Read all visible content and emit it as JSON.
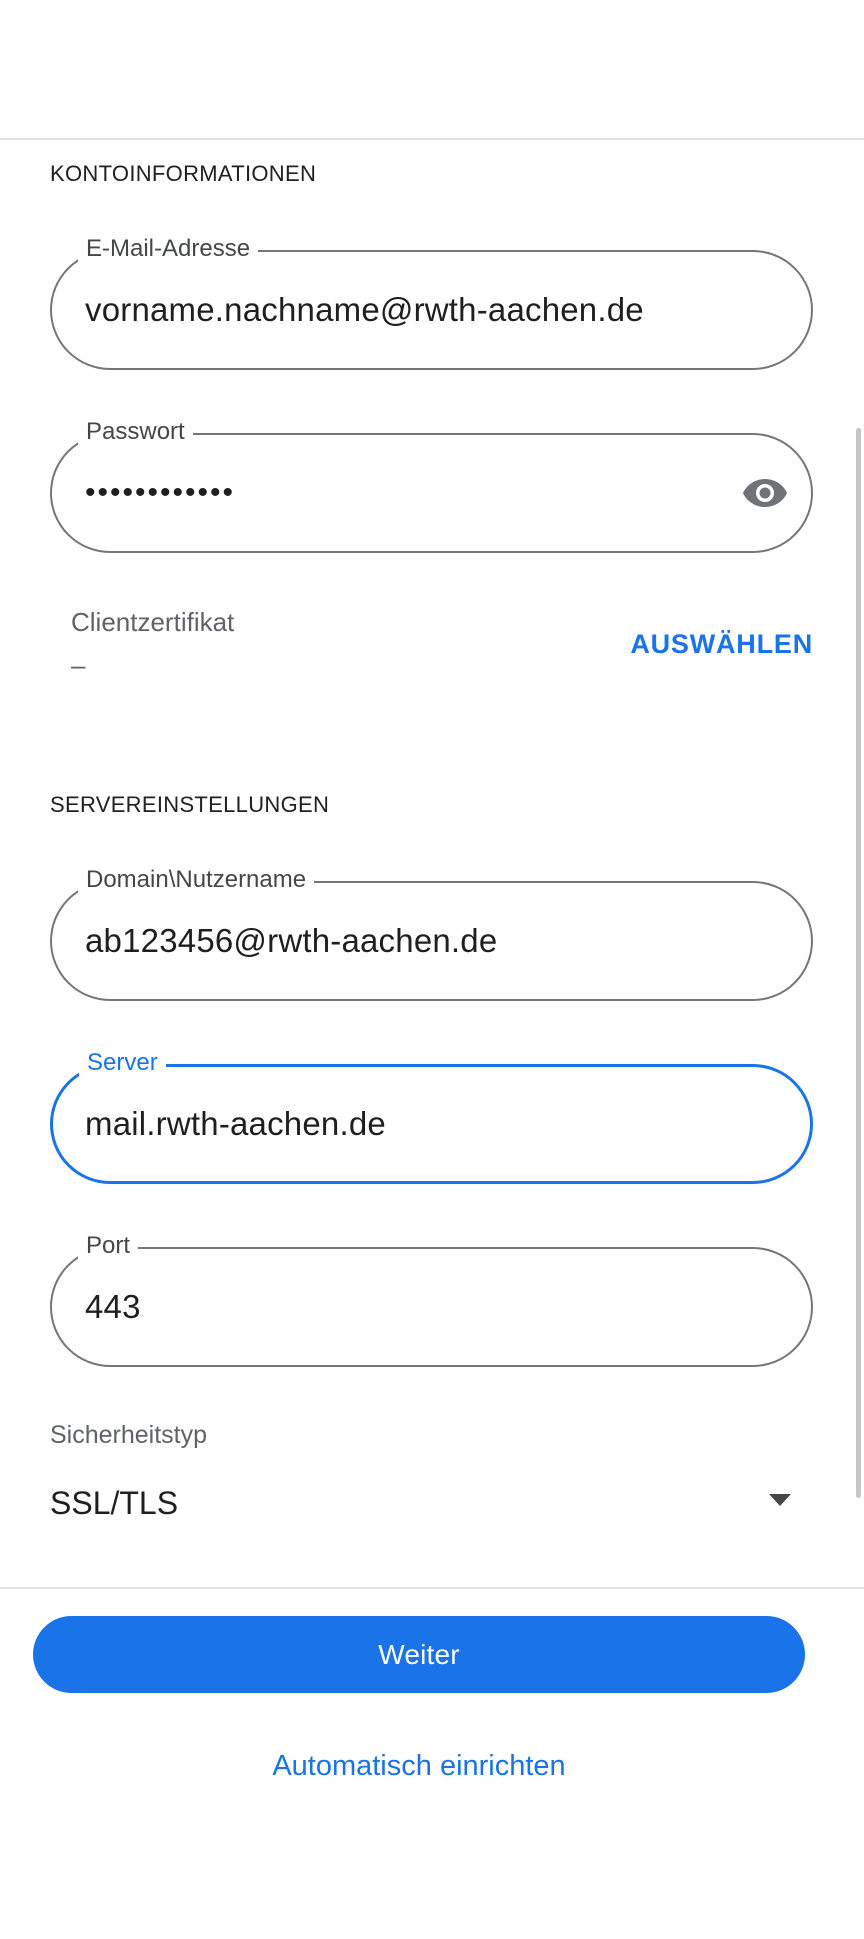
{
  "account_section": {
    "header": "KONTOINFORMATIONEN",
    "email": {
      "label": "E-Mail-Adresse",
      "value": "vorname.nachname@rwth-aachen.de"
    },
    "password": {
      "label": "Passwort",
      "value": "••••••••••••",
      "icon": "eye-icon"
    },
    "client_certificate": {
      "label": "Clientzertifikat",
      "value": "–",
      "action": "AUSWÄHLEN"
    }
  },
  "server_section": {
    "header": "SERVEREINSTELLUNGEN",
    "username": {
      "label": "Domain\\Nutzername",
      "value": "ab123456@rwth-aachen.de"
    },
    "server": {
      "label": "Server",
      "value": "mail.rwth-aachen.de"
    },
    "port": {
      "label": "Port",
      "value": "443"
    },
    "security_type": {
      "label": "Sicherheitstyp",
      "value": "SSL/TLS",
      "icon": "dropdown-arrow-icon"
    }
  },
  "actions": {
    "next": "Weiter",
    "auto_setup": "Automatisch einrichten"
  },
  "colors": {
    "accent": "#1a73e8",
    "outline": "#747775",
    "text": "#1f1f1f",
    "secondary_text": "#5f6368"
  }
}
